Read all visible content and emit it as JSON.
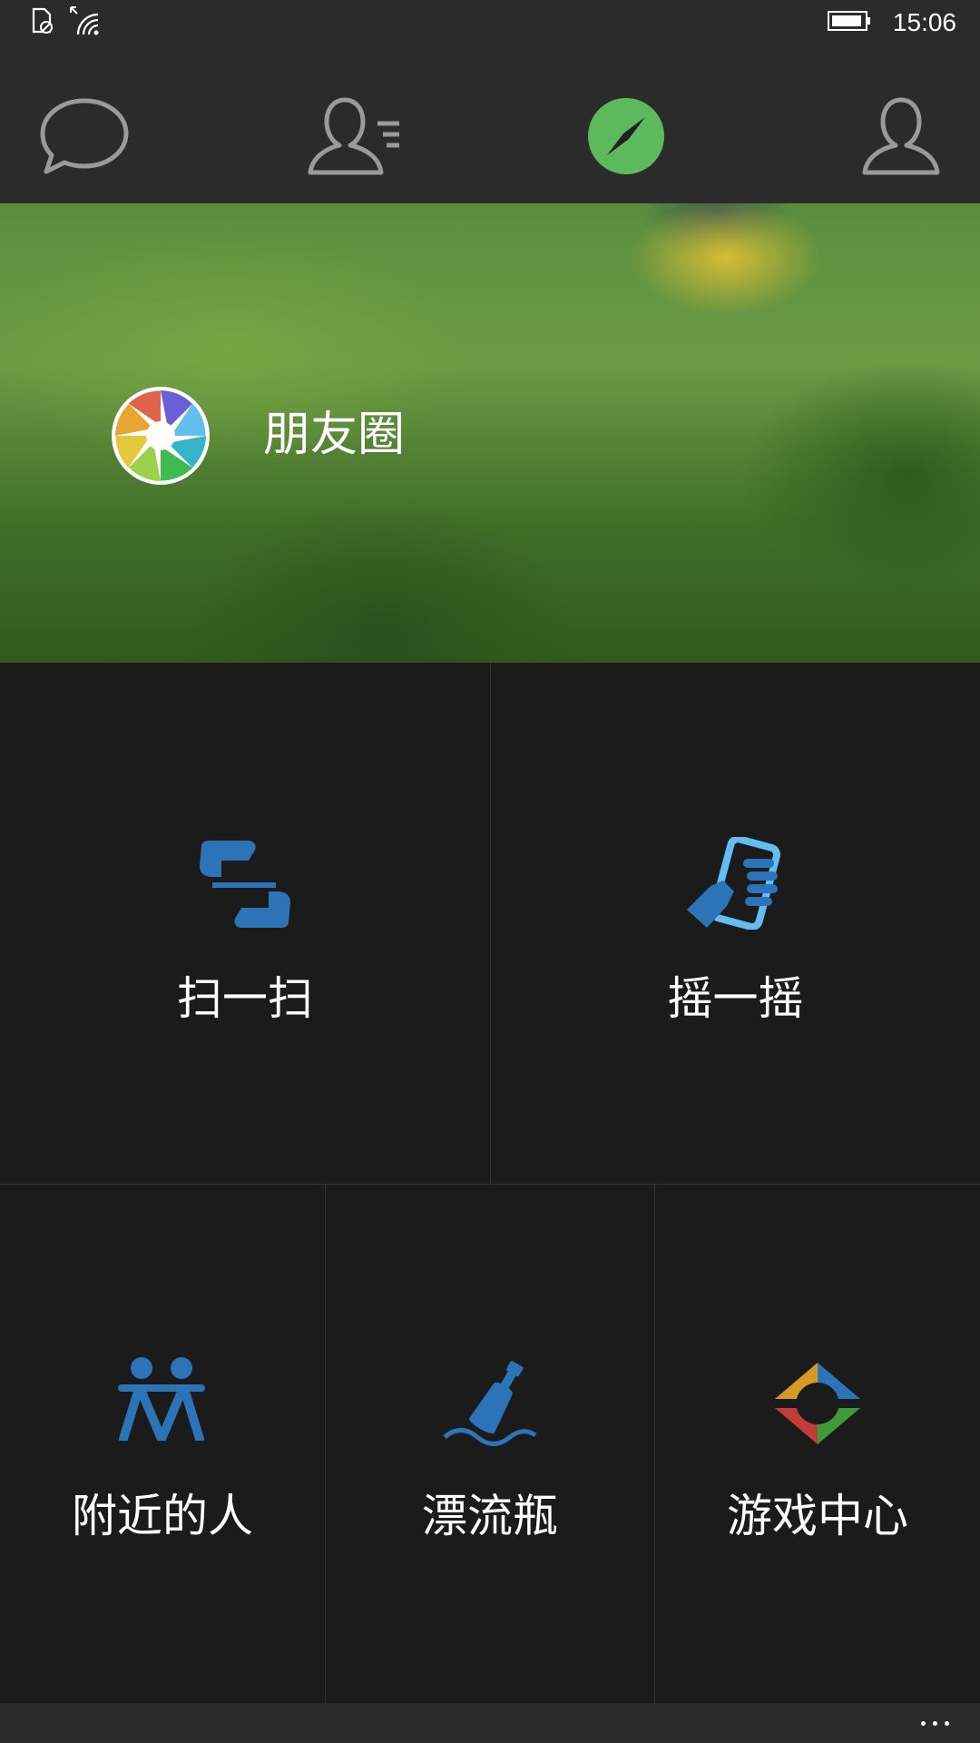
{
  "status_bar": {
    "time": "15:06",
    "icons": [
      "sim-block-icon",
      "wifi-icon",
      "battery-icon"
    ]
  },
  "nav": {
    "tabs": [
      {
        "name": "chats",
        "icon": "chat-bubble-icon",
        "active": false
      },
      {
        "name": "contacts",
        "icon": "contacts-icon",
        "active": false
      },
      {
        "name": "discover",
        "icon": "compass-icon",
        "active": true
      },
      {
        "name": "me",
        "icon": "person-icon",
        "active": false
      }
    ],
    "active_color": "#5cba5c",
    "inactive_color": "#9a9a9a"
  },
  "moments": {
    "label": "朋友圈",
    "icon": "moments-aperture-icon"
  },
  "tiles": {
    "scan": {
      "label": "扫一扫",
      "icon": "scan-icon"
    },
    "shake": {
      "label": "摇一摇",
      "icon": "shake-icon"
    },
    "nearby": {
      "label": "附近的人",
      "icon": "nearby-people-icon"
    },
    "bottle": {
      "label": "漂流瓶",
      "icon": "drift-bottle-icon"
    },
    "games": {
      "label": "游戏中心",
      "icon": "game-center-icon"
    }
  },
  "colors": {
    "icon_blue": "#2d73b8",
    "icon_light_blue": "#62bdf0",
    "background": "#1b1b1b",
    "bar": "#2b2b2b"
  },
  "app_bar": {
    "more_icon": "more-dots-icon"
  }
}
